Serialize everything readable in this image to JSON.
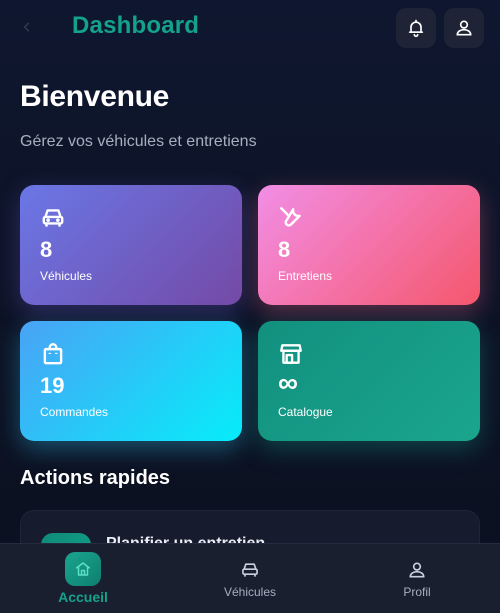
{
  "header": {
    "title": "Dashboard",
    "back_icon": "arrow-left-icon",
    "notification_icon": "bell-icon",
    "profile_icon": "user-icon"
  },
  "welcome": {
    "heading": "Bienvenue",
    "subtitle": "Gérez vos véhicules et entretiens"
  },
  "stats": [
    {
      "icon": "car-icon",
      "value": "8",
      "label": "Véhicules"
    },
    {
      "icon": "wrench-icon",
      "value": "8",
      "label": "Entretiens"
    },
    {
      "icon": "shopping-bag-icon",
      "value": "19",
      "label": "Commandes"
    },
    {
      "icon": "store-icon",
      "value": "∞",
      "label": "Catalogue"
    }
  ],
  "quick_actions": {
    "title": "Actions rapides",
    "items": [
      {
        "label": "Planifier un entretien",
        "icon": "calendar-icon"
      }
    ]
  },
  "bottom_nav": [
    {
      "label": "Accueil",
      "icon": "home-icon",
      "active": true
    },
    {
      "label": "Véhicules",
      "icon": "car-icon",
      "active": false
    },
    {
      "label": "Profil",
      "icon": "user-icon",
      "active": false
    }
  ],
  "colors": {
    "accent": "#14a28b",
    "background": "#0f1730",
    "card_vehicules": "#6a77e6",
    "card_entretiens": "#f5576c",
    "card_commandes": "#06edfa",
    "card_catalogue": "#12907f"
  }
}
